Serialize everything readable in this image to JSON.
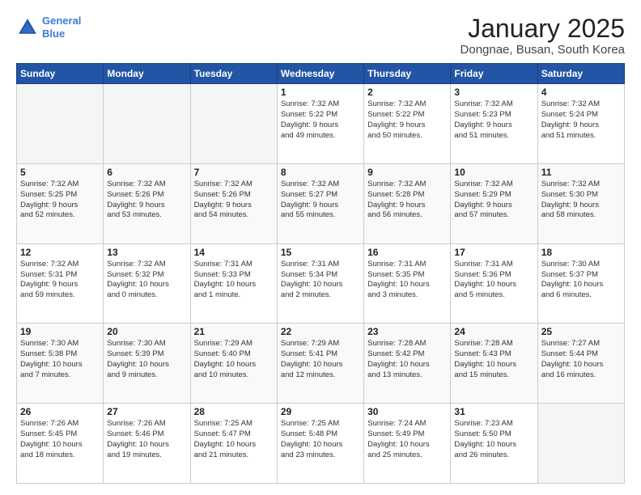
{
  "logo": {
    "line1": "General",
    "line2": "Blue"
  },
  "title": "January 2025",
  "subtitle": "Dongnae, Busan, South Korea",
  "days_of_week": [
    "Sunday",
    "Monday",
    "Tuesday",
    "Wednesday",
    "Thursday",
    "Friday",
    "Saturday"
  ],
  "weeks": [
    [
      {
        "num": "",
        "text": ""
      },
      {
        "num": "",
        "text": ""
      },
      {
        "num": "",
        "text": ""
      },
      {
        "num": "1",
        "text": "Sunrise: 7:32 AM\nSunset: 5:22 PM\nDaylight: 9 hours\nand 49 minutes."
      },
      {
        "num": "2",
        "text": "Sunrise: 7:32 AM\nSunset: 5:22 PM\nDaylight: 9 hours\nand 50 minutes."
      },
      {
        "num": "3",
        "text": "Sunrise: 7:32 AM\nSunset: 5:23 PM\nDaylight: 9 hours\nand 51 minutes."
      },
      {
        "num": "4",
        "text": "Sunrise: 7:32 AM\nSunset: 5:24 PM\nDaylight: 9 hours\nand 51 minutes."
      }
    ],
    [
      {
        "num": "5",
        "text": "Sunrise: 7:32 AM\nSunset: 5:25 PM\nDaylight: 9 hours\nand 52 minutes."
      },
      {
        "num": "6",
        "text": "Sunrise: 7:32 AM\nSunset: 5:26 PM\nDaylight: 9 hours\nand 53 minutes."
      },
      {
        "num": "7",
        "text": "Sunrise: 7:32 AM\nSunset: 5:26 PM\nDaylight: 9 hours\nand 54 minutes."
      },
      {
        "num": "8",
        "text": "Sunrise: 7:32 AM\nSunset: 5:27 PM\nDaylight: 9 hours\nand 55 minutes."
      },
      {
        "num": "9",
        "text": "Sunrise: 7:32 AM\nSunset: 5:28 PM\nDaylight: 9 hours\nand 56 minutes."
      },
      {
        "num": "10",
        "text": "Sunrise: 7:32 AM\nSunset: 5:29 PM\nDaylight: 9 hours\nand 57 minutes."
      },
      {
        "num": "11",
        "text": "Sunrise: 7:32 AM\nSunset: 5:30 PM\nDaylight: 9 hours\nand 58 minutes."
      }
    ],
    [
      {
        "num": "12",
        "text": "Sunrise: 7:32 AM\nSunset: 5:31 PM\nDaylight: 9 hours\nand 59 minutes."
      },
      {
        "num": "13",
        "text": "Sunrise: 7:32 AM\nSunset: 5:32 PM\nDaylight: 10 hours\nand 0 minutes."
      },
      {
        "num": "14",
        "text": "Sunrise: 7:31 AM\nSunset: 5:33 PM\nDaylight: 10 hours\nand 1 minute."
      },
      {
        "num": "15",
        "text": "Sunrise: 7:31 AM\nSunset: 5:34 PM\nDaylight: 10 hours\nand 2 minutes."
      },
      {
        "num": "16",
        "text": "Sunrise: 7:31 AM\nSunset: 5:35 PM\nDaylight: 10 hours\nand 3 minutes."
      },
      {
        "num": "17",
        "text": "Sunrise: 7:31 AM\nSunset: 5:36 PM\nDaylight: 10 hours\nand 5 minutes."
      },
      {
        "num": "18",
        "text": "Sunrise: 7:30 AM\nSunset: 5:37 PM\nDaylight: 10 hours\nand 6 minutes."
      }
    ],
    [
      {
        "num": "19",
        "text": "Sunrise: 7:30 AM\nSunset: 5:38 PM\nDaylight: 10 hours\nand 7 minutes."
      },
      {
        "num": "20",
        "text": "Sunrise: 7:30 AM\nSunset: 5:39 PM\nDaylight: 10 hours\nand 9 minutes."
      },
      {
        "num": "21",
        "text": "Sunrise: 7:29 AM\nSunset: 5:40 PM\nDaylight: 10 hours\nand 10 minutes."
      },
      {
        "num": "22",
        "text": "Sunrise: 7:29 AM\nSunset: 5:41 PM\nDaylight: 10 hours\nand 12 minutes."
      },
      {
        "num": "23",
        "text": "Sunrise: 7:28 AM\nSunset: 5:42 PM\nDaylight: 10 hours\nand 13 minutes."
      },
      {
        "num": "24",
        "text": "Sunrise: 7:28 AM\nSunset: 5:43 PM\nDaylight: 10 hours\nand 15 minutes."
      },
      {
        "num": "25",
        "text": "Sunrise: 7:27 AM\nSunset: 5:44 PM\nDaylight: 10 hours\nand 16 minutes."
      }
    ],
    [
      {
        "num": "26",
        "text": "Sunrise: 7:26 AM\nSunset: 5:45 PM\nDaylight: 10 hours\nand 18 minutes."
      },
      {
        "num": "27",
        "text": "Sunrise: 7:26 AM\nSunset: 5:46 PM\nDaylight: 10 hours\nand 19 minutes."
      },
      {
        "num": "28",
        "text": "Sunrise: 7:25 AM\nSunset: 5:47 PM\nDaylight: 10 hours\nand 21 minutes."
      },
      {
        "num": "29",
        "text": "Sunrise: 7:25 AM\nSunset: 5:48 PM\nDaylight: 10 hours\nand 23 minutes."
      },
      {
        "num": "30",
        "text": "Sunrise: 7:24 AM\nSunset: 5:49 PM\nDaylight: 10 hours\nand 25 minutes."
      },
      {
        "num": "31",
        "text": "Sunrise: 7:23 AM\nSunset: 5:50 PM\nDaylight: 10 hours\nand 26 minutes."
      },
      {
        "num": "",
        "text": ""
      }
    ]
  ]
}
